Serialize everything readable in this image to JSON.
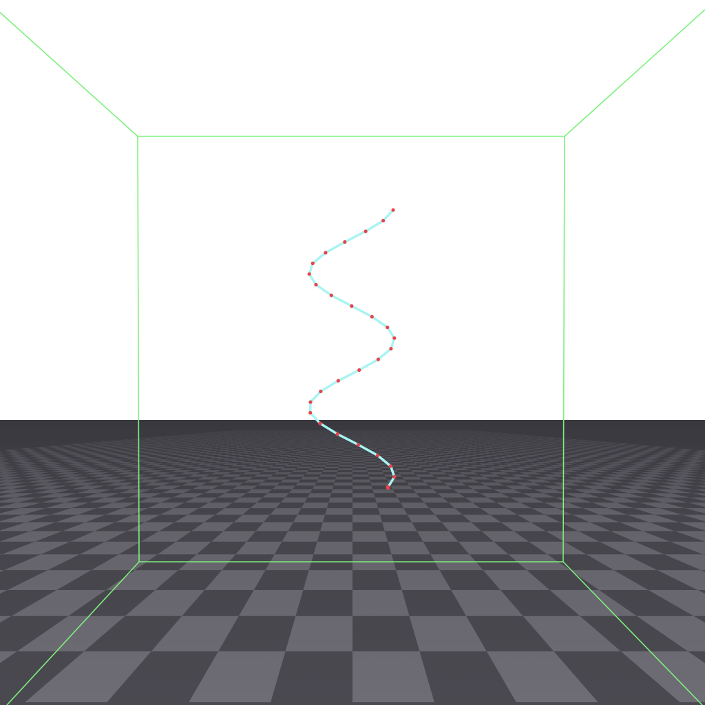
{
  "scene": {
    "colors": {
      "sky": "#ffffff",
      "floor_light": "#6e6c74",
      "floor_dark": "#4a4950",
      "box_edges": "#7ef07e",
      "rope": "#a8f4f2",
      "rope_nodes": "#e8434a"
    },
    "rope": {
      "node_count": 27
    }
  }
}
